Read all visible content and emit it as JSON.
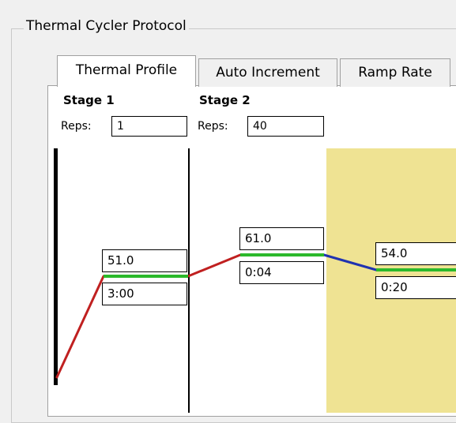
{
  "group": {
    "title": "Thermal Cycler Protocol"
  },
  "tabs": [
    {
      "label": "Thermal Profile",
      "active": true
    },
    {
      "label": "Auto Increment",
      "active": false
    },
    {
      "label": "Ramp Rate",
      "active": false
    }
  ],
  "stages": [
    {
      "title": "Stage 1",
      "reps_label": "Reps:",
      "reps": "1"
    },
    {
      "title": "Stage 2",
      "reps_label": "Reps:",
      "reps": "40"
    }
  ],
  "steps": [
    {
      "temperature": "51.0",
      "time": "3:00"
    },
    {
      "temperature": "61.0",
      "time": "0:04"
    },
    {
      "temperature": "54.0",
      "time": "0:20"
    }
  ],
  "colors": {
    "hold": "#2bb92b",
    "ramp_up": "#c02020",
    "ramp_down": "#2033b0",
    "highlight": "#efe393"
  }
}
